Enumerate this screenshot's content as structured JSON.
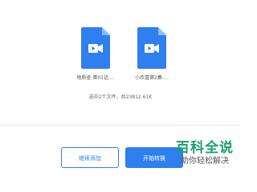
{
  "files": [
    {
      "name": "地质查 第01话 ...",
      "icon": "video-file-icon",
      "color": "#2f80ee"
    },
    {
      "name": "小欢喜第2集-...",
      "icon": "video-file-icon",
      "color": "#2f80ee"
    }
  ],
  "summary": "选中2个文件，共23812.61K",
  "buttons": {
    "continue_label": "继续添加",
    "start_label": "开始转换"
  },
  "watermark": {
    "main": "百科全说",
    "sub": "助你轻松解决"
  },
  "colors": {
    "accent": "#2f80ee",
    "watermark": "#1aa068"
  }
}
